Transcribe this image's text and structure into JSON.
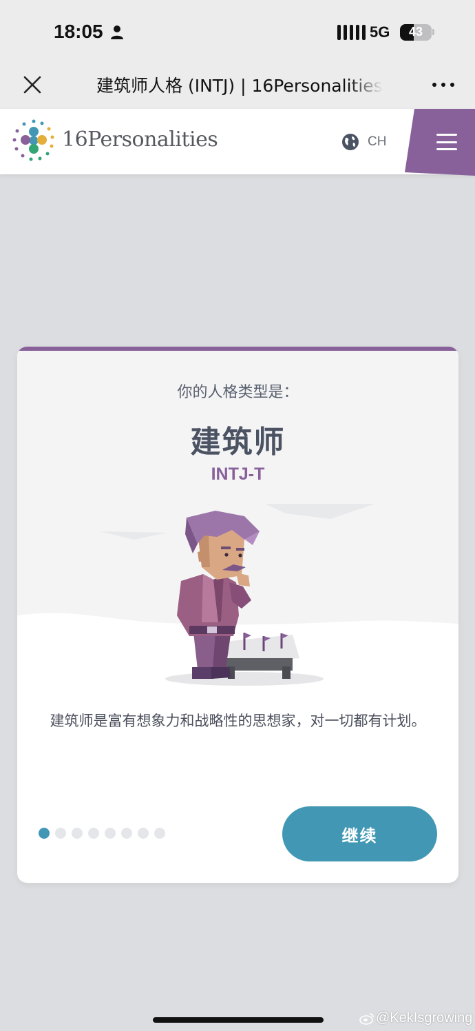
{
  "status_bar": {
    "time": "18:05",
    "network": "5G",
    "battery": "43",
    "battery_level_percent": 43
  },
  "nav_bar": {
    "title": "建筑师人格 (INTJ) | 16Personalities"
  },
  "site_header": {
    "brand": "16Personalities",
    "language": "CH"
  },
  "card": {
    "prompt": "你的人格类型是：",
    "type_name": "建筑师",
    "type_code": "INTJ-T",
    "description": "建筑师是富有想象力和战略性的思想家，对一切都有计划。",
    "continue_label": "继续",
    "pagination": {
      "total": 8,
      "current": 1
    }
  },
  "watermark": "@KekIsgrowing",
  "colors": {
    "accent_purple": "#88619a",
    "button_teal": "#4298b4",
    "background": "#dcdde0"
  }
}
